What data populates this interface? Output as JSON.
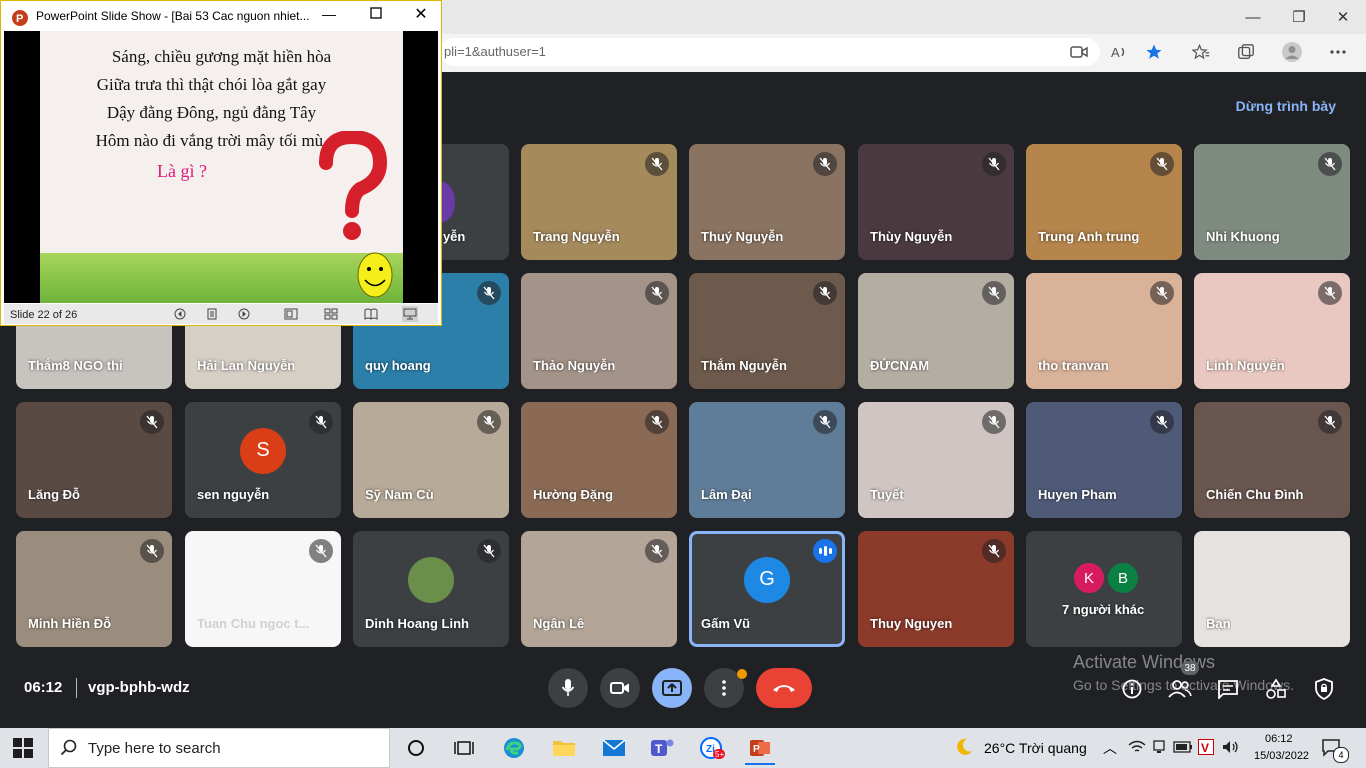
{
  "browser": {
    "url_fragment": "pli=1&authuser=1",
    "min_glyph": "—",
    "max_glyph": "❐",
    "close_glyph": "✕"
  },
  "meet": {
    "stop_presenting": "Dừng trình bày",
    "time": "06:12",
    "code": "vgp-bphb-wdz",
    "people_count": "38",
    "watermark_title": "Activate Windows",
    "watermark_sub": "Go to Settings to activate Windows.",
    "partial_tile_name": "uyễn",
    "tiles": [
      {
        "name": "Trang Nguyễn",
        "muted": true,
        "bg": "#a58a5c"
      },
      {
        "name": "Thuý Nguyễn",
        "muted": true,
        "bg": "#8a7360"
      },
      {
        "name": "Thùy Nguyễn",
        "muted": true,
        "bg": "#4a3a3f"
      },
      {
        "name": "Trung Anh trung",
        "muted": true,
        "bg": "#b5854c"
      },
      {
        "name": "Nhi Khuong",
        "muted": true,
        "bg": "#7f8a80"
      },
      {
        "name": "Thắm8 NGO thi",
        "muted": false,
        "bg": "#c7c3bf"
      },
      {
        "name": "Hải Lan Nguyễn",
        "muted": false,
        "bg": "#d6cfc6"
      },
      {
        "name": "quy hoang",
        "muted": true,
        "bg": "#2b7fa8"
      },
      {
        "name": "Thảo Nguyễn",
        "muted": true,
        "bg": "#a49388"
      },
      {
        "name": "Thắm Nguyễn",
        "muted": true,
        "bg": "#6d5a4c"
      },
      {
        "name": "ĐỨCNAM",
        "muted": true,
        "bg": "#b3ada3"
      },
      {
        "name": "tho tranvan",
        "muted": true,
        "bg": "#d9b29a"
      },
      {
        "name": "Linh Nguyễn",
        "muted": true,
        "bg": "#e8c8c0"
      },
      {
        "name": "Lăng Đỗ",
        "muted": true,
        "bg": "#5a4a44"
      },
      {
        "name": "sen nguyễn",
        "muted": true,
        "bg": "#3c4043",
        "avatar": "S",
        "avatar_color": "#d93e17"
      },
      {
        "name": "Sỹ Nam Cù",
        "muted": true,
        "bg": "#b8aa98"
      },
      {
        "name": "Hường Đặng",
        "muted": true,
        "bg": "#8a6a55"
      },
      {
        "name": "Lâm Đại",
        "muted": true,
        "bg": "#5f7d99"
      },
      {
        "name": "Tuyết",
        "muted": true,
        "bg": "#cfc5c2"
      },
      {
        "name": "Huyen Pham",
        "muted": true,
        "bg": "#4f5a78"
      },
      {
        "name": "Chiến Chu Đình",
        "muted": true,
        "bg": "#6a5650"
      },
      {
        "name": "Minh Hiền Đỗ",
        "muted": true,
        "bg": "#9b8d7d"
      },
      {
        "name": "Tuan Chu ngoc t...",
        "muted": true,
        "bg": "#f7f7f7"
      },
      {
        "name": "Dinh Hoang Linh",
        "muted": true,
        "bg": "#3c4043",
        "avatar": "",
        "avatar_color": "#6a8f4a"
      },
      {
        "name": "Ngân Lê",
        "muted": true,
        "bg": "#b3a597"
      },
      {
        "name": "Gấm Vũ",
        "muted": false,
        "bg": "#3c4043",
        "avatar": "G",
        "avatar_color": "#1e88e5",
        "speaking": true
      },
      {
        "name": "Thuy Nguyen",
        "muted": true,
        "bg": "#8c3a2a"
      },
      {
        "name": "7 người khác",
        "muted": false,
        "bg": "#3c4043",
        "others": true
      },
      {
        "name": "Bạn",
        "muted": false,
        "bg": "#e5e2df"
      }
    ],
    "others_avatars": [
      {
        "letter": "K",
        "color": "#d81b60"
      },
      {
        "letter": "B",
        "color": "#0b8043"
      }
    ]
  },
  "ppt": {
    "title": "PowerPoint Slide Show - [Bai 53 Cac nguon nhiet...",
    "slide_lines": [
      "Sáng, chiều gương mặt hiền hòa",
      "Giữa trưa thì thật chói lòa gắt gay",
      "Dậy đằng Đông, ngủ đằng Tây",
      "Hôm nào đi vắng trời mây tối mù."
    ],
    "question": "Là gì ?",
    "slide_counter": "Slide 22 of 26"
  },
  "taskbar": {
    "search_placeholder": "Type here to search",
    "weather": "26°C  Trời quang",
    "time": "06:12",
    "date": "15/03/2022",
    "notif_count": "4"
  }
}
